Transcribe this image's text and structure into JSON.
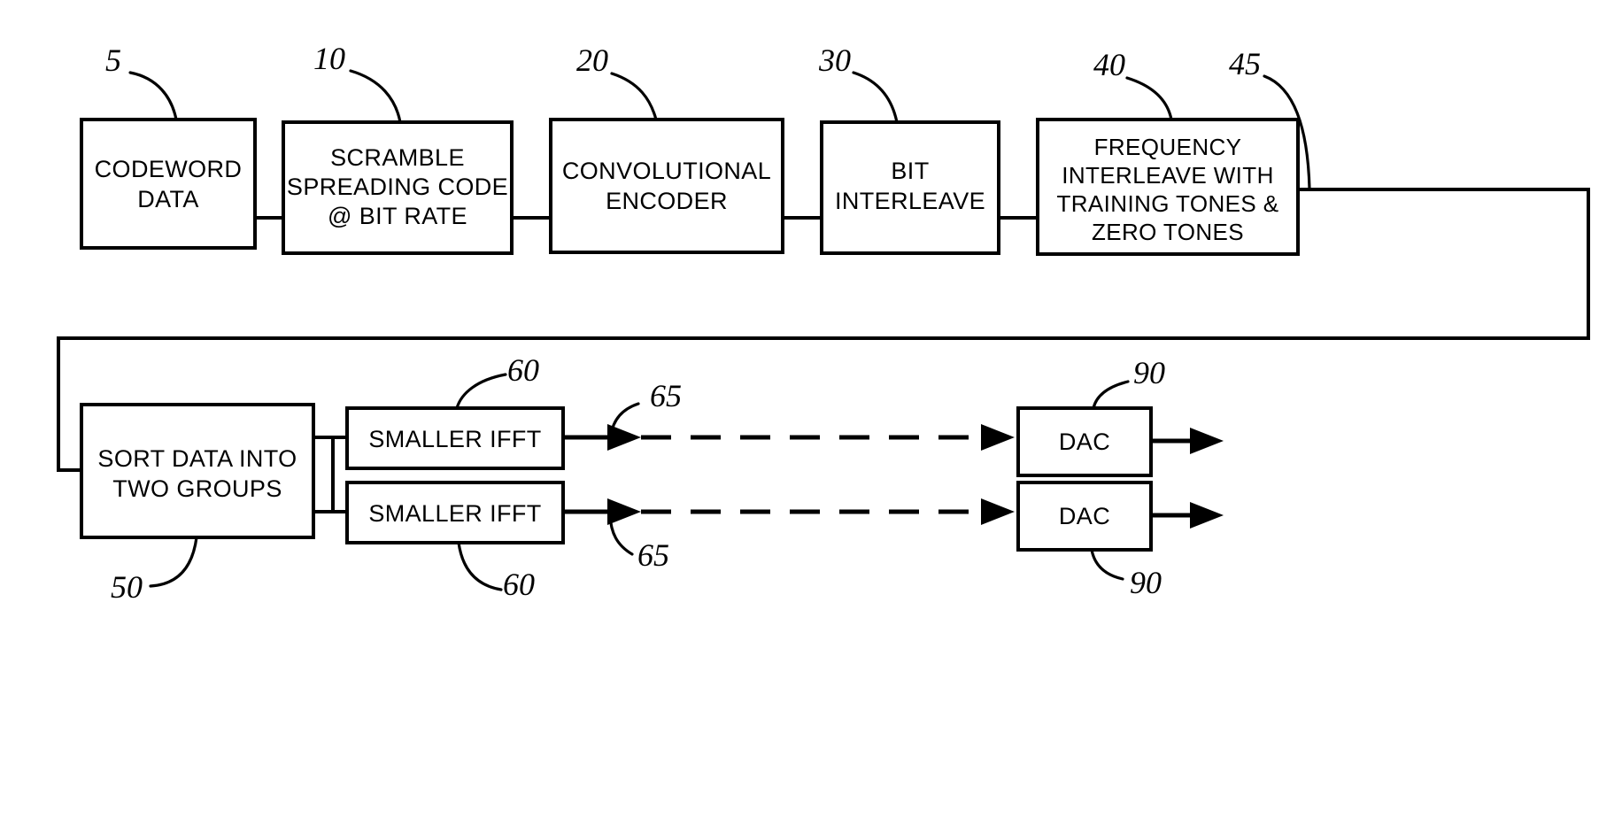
{
  "figure": {
    "type": "patent-block-diagram",
    "background_color": "#ffffff",
    "line_color": "#000000"
  },
  "blocks": {
    "codeword_data": {
      "label_line1": "CODEWORD",
      "label_line2": "DATA"
    },
    "scramble": {
      "label_line1": "SCRAMBLE",
      "label_line2": "SPREADING CODE",
      "label_line3": "@ BIT RATE"
    },
    "convolutional_encoder": {
      "label_line1": "CONVOLUTIONAL",
      "label_line2": "ENCODER"
    },
    "bit_interleave": {
      "label_line1": "BIT",
      "label_line2": "INTERLEAVE"
    },
    "frequency_interleave": {
      "label_line1": "FREQUENCY",
      "label_line2": "INTERLEAVE WITH",
      "label_line3": "TRAINING TONES &",
      "label_line4": "ZERO TONES"
    },
    "sort_data": {
      "label_line1": "SORT DATA INTO",
      "label_line2": "TWO GROUPS"
    },
    "smaller_ifft_top": {
      "label": "SMALLER IFFT"
    },
    "smaller_ifft_bottom": {
      "label": "SMALLER IFFT"
    },
    "dac_top": {
      "label": "DAC"
    },
    "dac_bottom": {
      "label": "DAC"
    }
  },
  "reference_numerals": {
    "codeword_data": "5",
    "scramble": "10",
    "convolutional_encoder": "20",
    "bit_interleave": "30",
    "frequency_interleave": "40",
    "feedback_wire": "45",
    "sort_data": "50",
    "smaller_ifft_top": "60",
    "smaller_ifft_bottom": "60",
    "ifft_output_top": "65",
    "ifft_output_bottom": "65",
    "dac_top": "90",
    "dac_bottom": "90"
  }
}
